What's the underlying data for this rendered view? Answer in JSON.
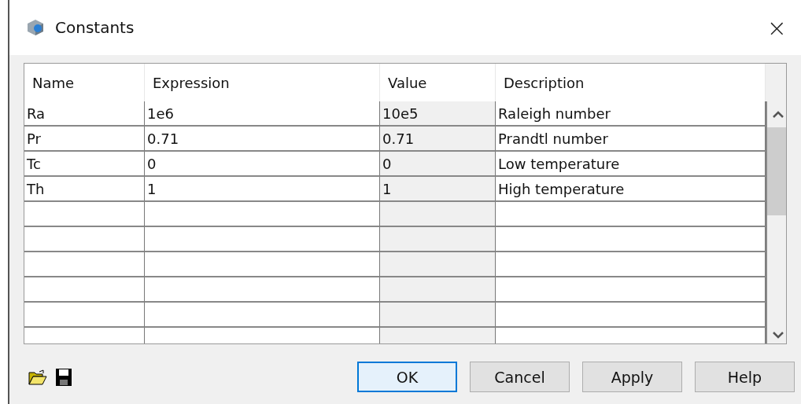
{
  "window": {
    "title": "Constants",
    "close": "×"
  },
  "table": {
    "columns": [
      "Name",
      "Expression",
      "Value",
      "Description"
    ],
    "rows": [
      {
        "cells": [
          "Ra",
          "1e6",
          "10e5",
          "Raleigh number"
        ]
      },
      {
        "cells": [
          "Pr",
          "0.71",
          "0.71",
          "Prandtl number"
        ]
      },
      {
        "cells": [
          "Tc",
          "0",
          "0",
          "Low temperature"
        ]
      },
      {
        "cells": [
          "Th",
          "1",
          "1",
          "High temperature"
        ]
      }
    ]
  },
  "buttons": [
    {
      "label": "OK",
      "default": true
    },
    {
      "label": "Cancel",
      "default": false
    },
    {
      "label": "Apply",
      "default": false
    },
    {
      "label": "Help",
      "default": false
    }
  ]
}
